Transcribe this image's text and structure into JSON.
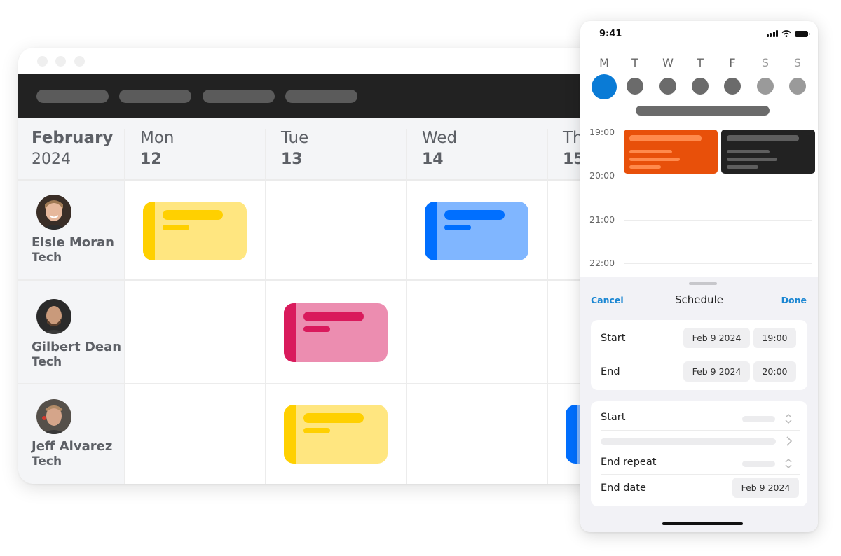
{
  "desktop": {
    "window_controls": [
      "close",
      "minimize",
      "maximize"
    ],
    "nav_pills": 4,
    "header": {
      "month": "February",
      "year": "2024",
      "days": [
        {
          "name": "Mon",
          "date": "12"
        },
        {
          "name": "Tue",
          "date": "13"
        },
        {
          "name": "Wed",
          "date": "14"
        },
        {
          "name": "Thu",
          "date": "15"
        }
      ]
    },
    "people": [
      {
        "name": "Elsie Moran",
        "role": "Tech"
      },
      {
        "name": "Gilbert Dean",
        "role": "Tech"
      },
      {
        "name": "Jeff Alvarez",
        "role": "Tech"
      }
    ],
    "events": [
      {
        "person": 0,
        "day": 0,
        "color": "yellow",
        "accent": "#ffd000",
        "fill": "#ffe680"
      },
      {
        "person": 0,
        "day": 2,
        "color": "blue",
        "accent": "#006fff",
        "fill": "#80b6ff"
      },
      {
        "person": 1,
        "day": 1,
        "color": "pink",
        "accent": "#d91a5c",
        "fill": "#ec8db0"
      },
      {
        "person": 2,
        "day": 1,
        "color": "yellow",
        "accent": "#ffd000",
        "fill": "#ffe680"
      },
      {
        "person": 2,
        "day": 3,
        "color": "blue",
        "accent": "#006fff",
        "fill": "#80b6ff"
      }
    ]
  },
  "phone": {
    "status": {
      "time": "9:41",
      "icons": [
        "signal-icon",
        "wifi-icon",
        "battery-icon"
      ]
    },
    "weekdays": [
      "M",
      "T",
      "W",
      "T",
      "F",
      "S",
      "S"
    ],
    "selected_day_index": 0,
    "hours": [
      "19:00",
      "20:00",
      "21:00",
      "22:00"
    ],
    "events": [
      {
        "color": "#e8500a",
        "label_color": "#ff8a4c"
      },
      {
        "color": "#222222",
        "label_color": "#5e5e5e"
      }
    ],
    "sheet": {
      "cancel": "Cancel",
      "title": "Schedule",
      "done": "Done",
      "start_label": "Start",
      "start_date": "Feb 9 2024",
      "start_time": "19:00",
      "end_label": "End",
      "end_date": "Feb 9 2024",
      "end_time": "20:00",
      "repeat_start_label": "Start",
      "end_repeat_label": "End repeat",
      "end_date_label": "End date",
      "end_date_value": "Feb 9 2024"
    }
  }
}
